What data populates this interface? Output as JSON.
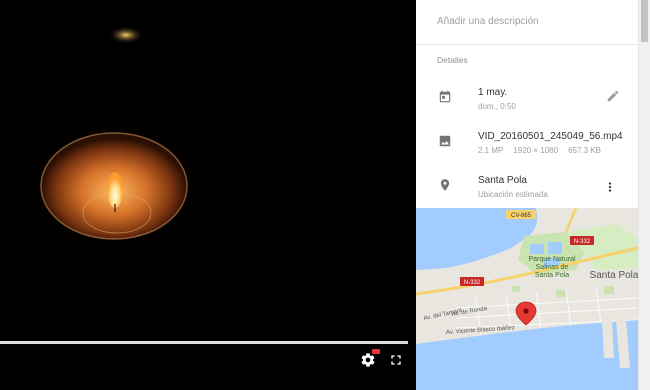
{
  "info": {
    "description_placeholder": "Añadir una descripción",
    "section_title": "Detalles",
    "date": {
      "title": "1 may.",
      "subtitle": "dom., 0:50"
    },
    "file": {
      "name": "VID_20160501_245049_56.mp4",
      "megapixels": "2.1 MP",
      "resolution": "1920 × 1080",
      "size": "657.3 KB"
    },
    "location": {
      "name": "Santa Pola",
      "subtitle": "Ubicación estimada"
    }
  },
  "map": {
    "labels": {
      "cv865": "CV-865",
      "n332_top": "N-332",
      "n332_left": "N-332",
      "parque_1": "Parque Natural",
      "parque_2": "Salinas de",
      "parque_3": "Santa Pola",
      "town": "Santa Pola",
      "tamarit": "Av. del Tamarit",
      "ronda": "Av. de Ronda",
      "vicente": "Av. Vicente Blasco Ibáñez"
    },
    "colors": {
      "sea": "#a3ccfe",
      "land": "#e8e6df",
      "park": "#c9e3b1",
      "road": "#f7d26a",
      "marker": "#e53935"
    }
  },
  "player": {
    "progress_fraction": 0.98,
    "icons": {
      "settings": "settings-icon",
      "fullscreen": "fullscreen-icon"
    }
  }
}
